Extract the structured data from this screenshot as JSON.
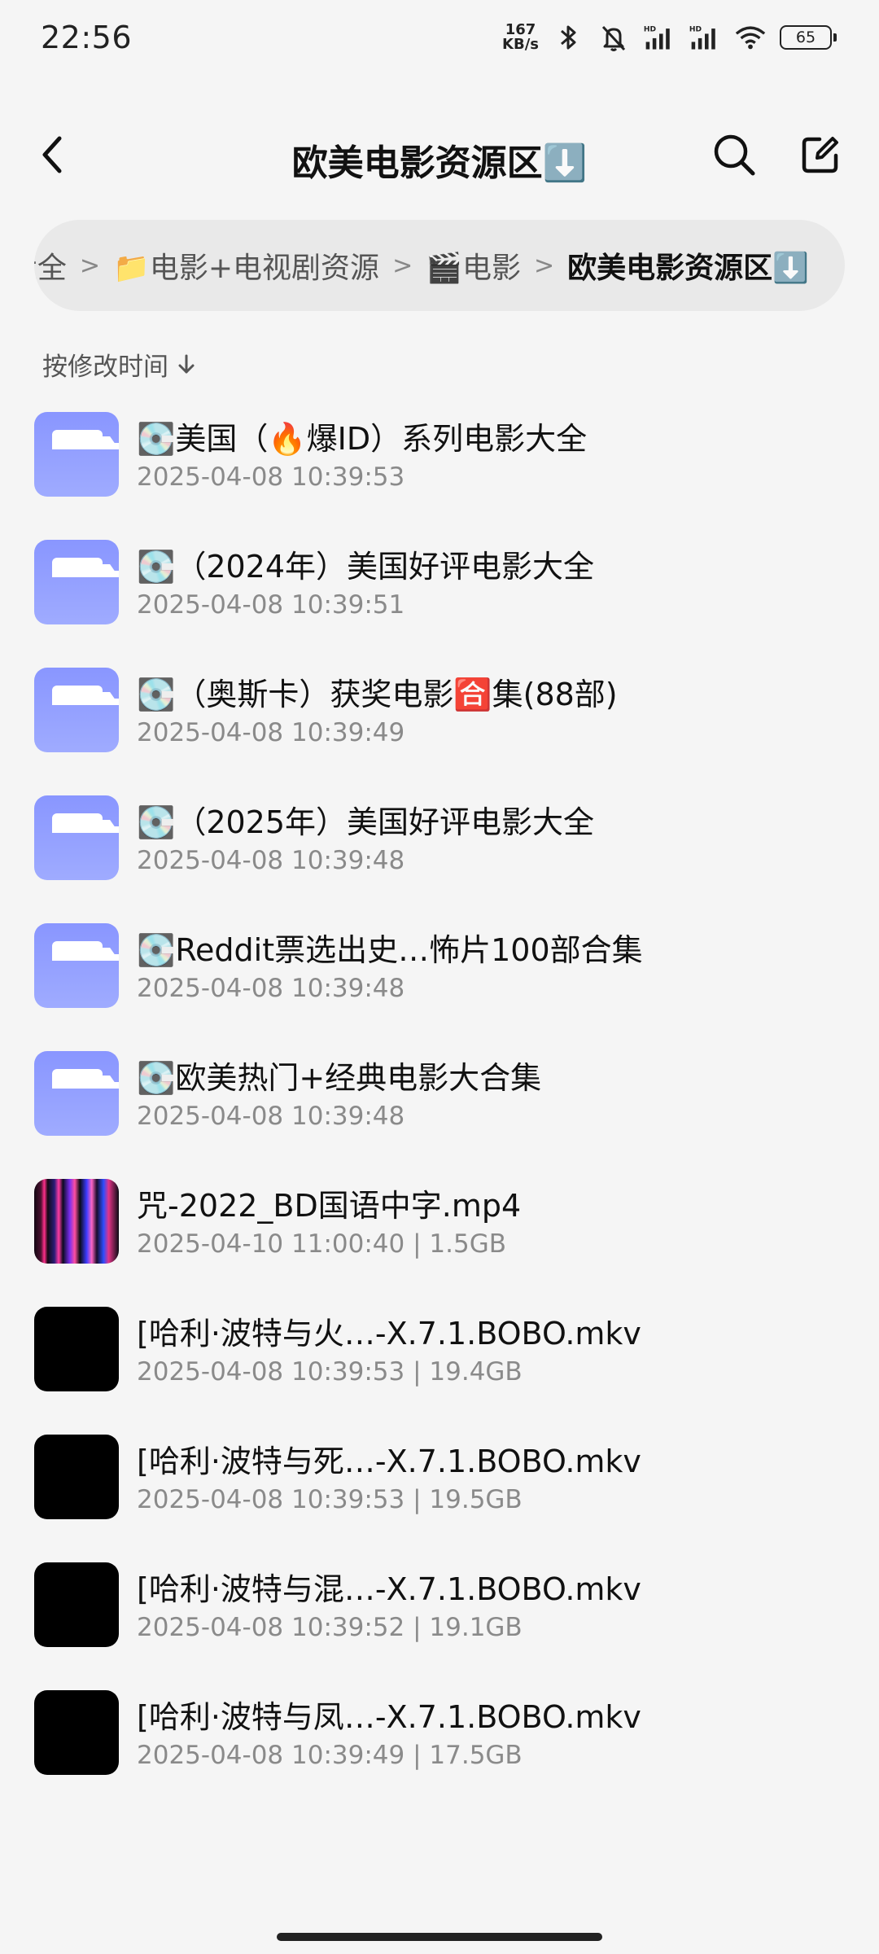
{
  "status_bar": {
    "time": "22:56",
    "net_speed_value": "167",
    "net_speed_unit": "KB/s",
    "icons": [
      "bluetooth-icon",
      "mute-icon",
      "signal-hd-icon",
      "signal-hd-icon",
      "wifi-icon"
    ],
    "battery": "65"
  },
  "header": {
    "title": "欧美电影资源区⬇️"
  },
  "breadcrumb": [
    "大全",
    "📁电影+电视剧资源",
    "🎬电影",
    "欧美电影资源区⬇️"
  ],
  "sort": {
    "label": "按修改时间"
  },
  "files": [
    {
      "type": "folder",
      "name": "💽美国（🔥爆ID）系列电影大全",
      "meta": "2025-04-08 10:39:53"
    },
    {
      "type": "folder",
      "name": "💽（2024年）美国好评电影大全",
      "meta": "2025-04-08 10:39:51"
    },
    {
      "type": "folder",
      "name": "💽（奥斯卡）获奖电影🈴集(88部)",
      "meta": "2025-04-08 10:39:49"
    },
    {
      "type": "folder",
      "name": "💽（2025年）美国好评电影大全",
      "meta": "2025-04-08 10:39:48"
    },
    {
      "type": "folder",
      "name": "💽Reddit票选出史…怖片100部合集",
      "meta": "2025-04-08 10:39:48"
    },
    {
      "type": "folder",
      "name": "💽欧美热门+经典电影大合集",
      "meta": "2025-04-08 10:39:48"
    },
    {
      "type": "video",
      "name": "咒-2022_BD国语中字.mp4",
      "meta": "2025-04-10 11:00:40 | 1.5GB"
    },
    {
      "type": "video",
      "name": "[哈利·波特与火…-X.7.1.BOBO.mkv",
      "meta": "2025-04-08 10:39:53 | 19.4GB"
    },
    {
      "type": "video",
      "name": "[哈利·波特与死…-X.7.1.BOBO.mkv",
      "meta": "2025-04-08 10:39:53 | 19.5GB"
    },
    {
      "type": "video",
      "name": "[哈利·波特与混…-X.7.1.BOBO.mkv",
      "meta": "2025-04-08 10:39:52 | 19.1GB"
    },
    {
      "type": "video",
      "name": "[哈利·波特与凤…-X.7.1.BOBO.mkv",
      "meta": "2025-04-08 10:39:49 | 17.5GB"
    }
  ]
}
